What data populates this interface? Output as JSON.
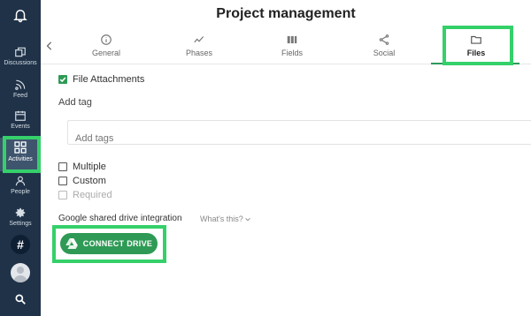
{
  "header": {
    "title": "Project management"
  },
  "sidebar": {
    "items": [
      {
        "label": ""
      },
      {
        "label": "Discussions"
      },
      {
        "label": "Feed"
      },
      {
        "label": "Events"
      },
      {
        "label": "Activities"
      },
      {
        "label": "People"
      },
      {
        "label": "Settings"
      },
      {
        "label": "#"
      },
      {
        "label": ""
      },
      {
        "label": ""
      }
    ]
  },
  "tabs": [
    {
      "label": "General",
      "icon": "info-icon"
    },
    {
      "label": "Phases",
      "icon": "trend-icon"
    },
    {
      "label": "Fields",
      "icon": "columns-icon"
    },
    {
      "label": "Social",
      "icon": "share-icon"
    },
    {
      "label": "Files",
      "icon": "folder-icon",
      "active": true
    }
  ],
  "form": {
    "file_attachments_label": "File Attachments",
    "add_tag_label": "Add tag",
    "add_tags_placeholder": "Add tags",
    "multiple_label": "Multiple",
    "custom_label": "Custom",
    "required_label": "Required",
    "google_drive_label": "Google shared drive integration",
    "whats_this": "What's this?",
    "connect_drive_label": "CONNECT DRIVE"
  },
  "colors": {
    "sidebar": "#1f3248",
    "accent": "#2e9a55",
    "highlight": "#35d06a"
  }
}
